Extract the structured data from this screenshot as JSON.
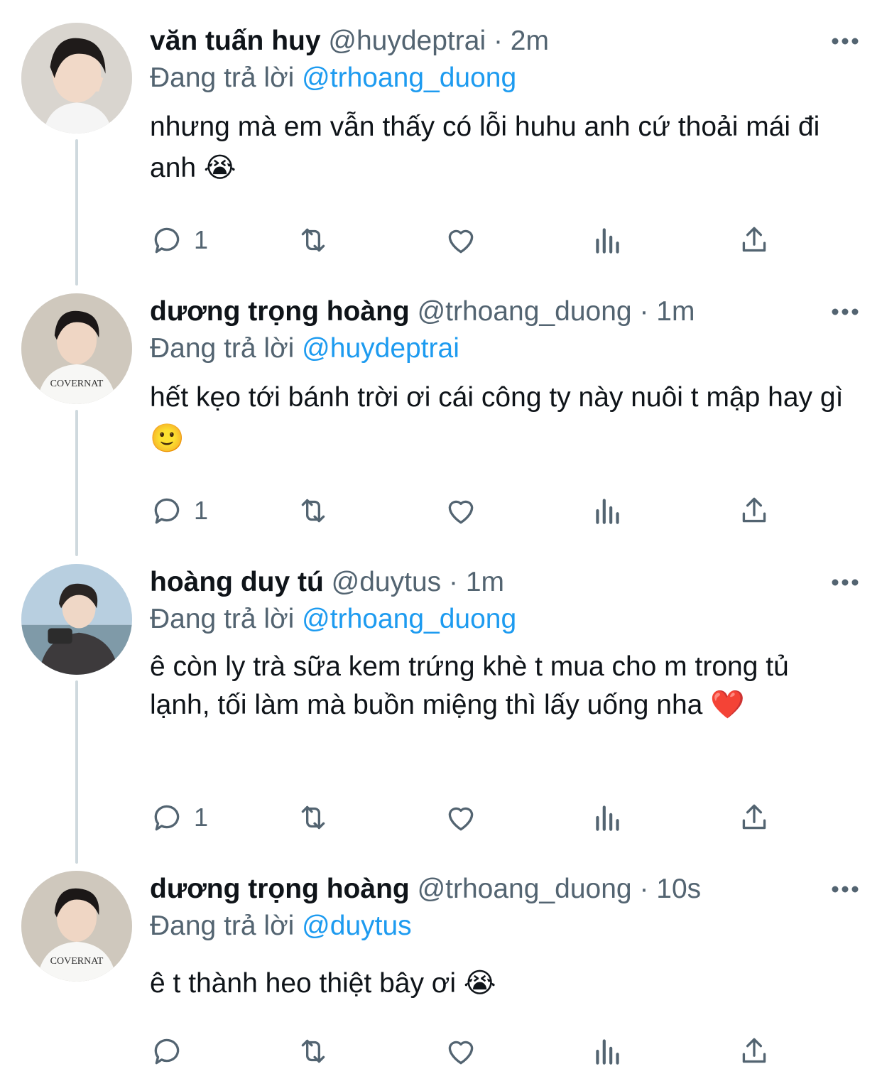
{
  "replying_prefix": "Đang trả lời",
  "dot": "·",
  "tweets": [
    {
      "name": "văn tuấn huy",
      "handle": "@huydeptrai",
      "time": "2m",
      "replying_to": "@trhoang_duong",
      "text": "nhưng mà em vẫn thấy có lỗi huhu anh cứ thoải mái đi anh 😭",
      "reply_count": "1",
      "avatar_icon": "avatar-peace-sign"
    },
    {
      "name": "dương trọng hoàng",
      "handle": "@trhoang_duong",
      "time": "1m",
      "replying_to": "@huydeptrai",
      "text": "hết kẹo tới bánh trời ơi cái công ty này nuôi t mập hay gì 🙂",
      "reply_count": "1",
      "avatar_icon": "avatar-covernat-shirt"
    },
    {
      "name": "hoàng duy tú",
      "handle": "@duytus",
      "time": "1m",
      "replying_to": "@trhoang_duong",
      "text": "ê còn ly trà sữa kem trứng khè t mua cho m trong tủ lạnh, tối làm mà buồn miệng thì lấy uống nha ❤️",
      "reply_count": "1",
      "avatar_icon": "avatar-camera-beach"
    },
    {
      "name": "dương trọng hoàng",
      "handle": "@trhoang_duong",
      "time": "10s",
      "replying_to": "@duytus",
      "text": "ê t thành heo thiệt bây ơi 😭",
      "reply_count": "",
      "avatar_icon": "avatar-covernat-shirt"
    }
  ]
}
